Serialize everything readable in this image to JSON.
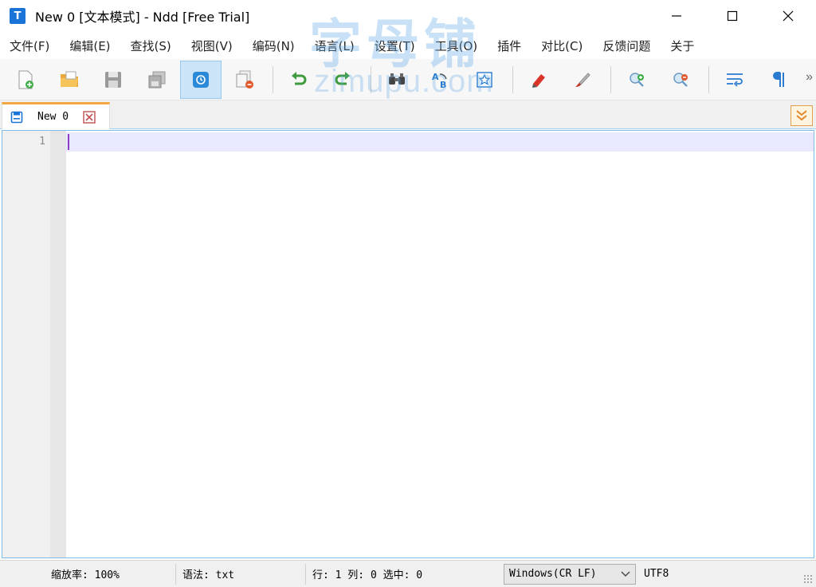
{
  "window": {
    "title": "New 0 [文本模式] - Ndd [Free Trial]",
    "app_icon_letter": "T"
  },
  "menu": {
    "items": [
      {
        "label": "文件(F)"
      },
      {
        "label": "编辑(E)"
      },
      {
        "label": "查找(S)"
      },
      {
        "label": "视图(V)"
      },
      {
        "label": "编码(N)"
      },
      {
        "label": "语言(L)"
      },
      {
        "label": "设置(T)"
      },
      {
        "label": "工具(O)"
      },
      {
        "label": "插件"
      },
      {
        "label": "对比(C)"
      },
      {
        "label": "反馈问题"
      },
      {
        "label": "关于"
      }
    ]
  },
  "toolbar": {
    "more_label": "»",
    "icons": [
      "new-file-icon",
      "open-folder-icon",
      "save-icon",
      "save-all-icon",
      "clipboard-icon",
      "close-file-icon",
      "undo-icon",
      "redo-icon",
      "find-icon",
      "replace-icon",
      "mark-icon",
      "highlighter-icon",
      "brush-icon",
      "zoom-in-icon",
      "zoom-out-icon",
      "wrap-icon",
      "pilcrow-icon"
    ]
  },
  "tabs": [
    {
      "label": "New 0"
    }
  ],
  "editor": {
    "line_numbers": [
      "1"
    ],
    "content": ""
  },
  "status": {
    "zoom": "缩放率: 100%",
    "syntax": "语法: txt",
    "position": "行: 1 列: 0 选中: 0",
    "eol": "Windows(CR LF)",
    "encoding": "UTF8"
  },
  "watermark": {
    "cn": "字母铺",
    "en": "zimupu.com"
  },
  "colors": {
    "accent": "#1a73d6",
    "tab_top": "#f3a743",
    "current_line": "#e8e8ff",
    "caret": "#8a3ec6",
    "active_button": "#cce4f7"
  }
}
